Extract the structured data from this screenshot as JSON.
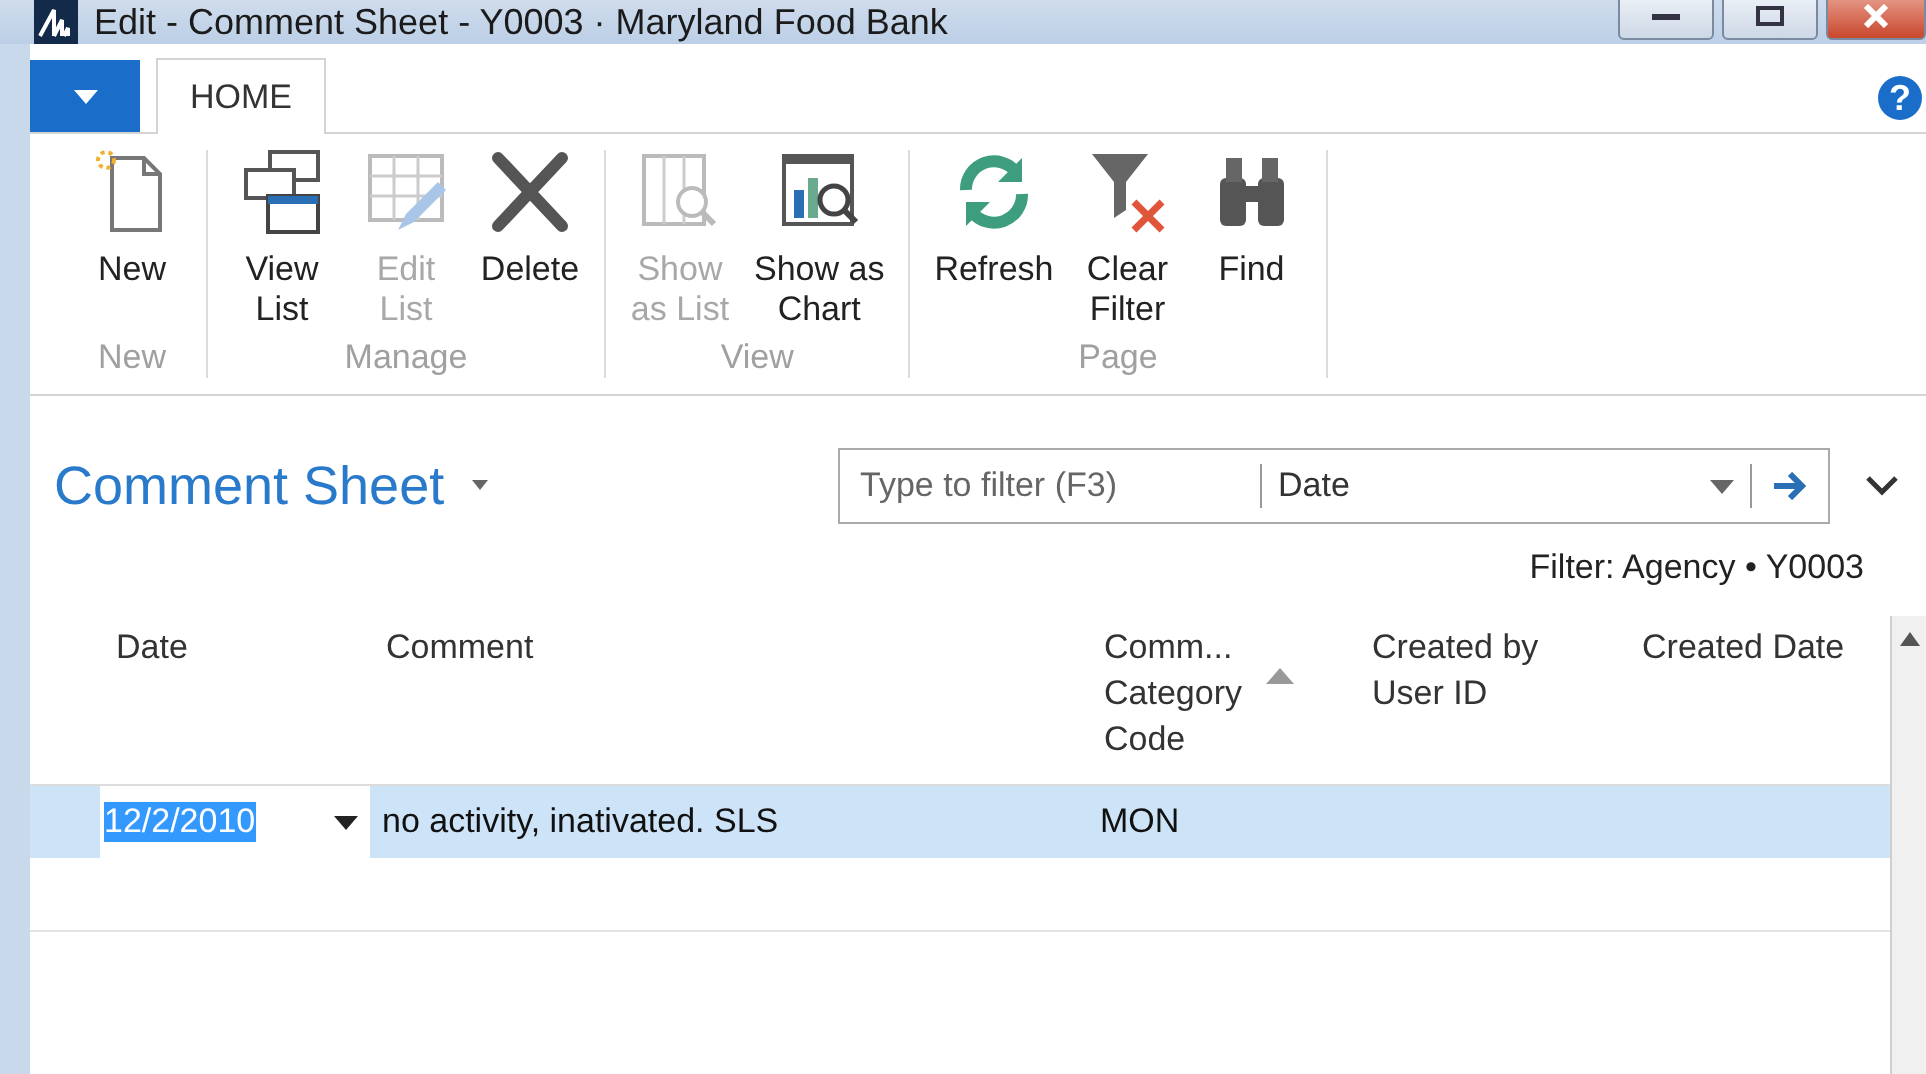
{
  "window": {
    "title": "Edit - Comment Sheet - Y0003 · Maryland Food Bank"
  },
  "tabs": [
    {
      "label": "HOME",
      "selected": true
    }
  ],
  "help": "?",
  "ribbon": [
    {
      "label": "New",
      "buttons": [
        {
          "lines": [
            "New"
          ],
          "kind": "new",
          "disabled": false
        }
      ]
    },
    {
      "label": "Manage",
      "buttons": [
        {
          "lines": [
            "View",
            "List"
          ],
          "kind": "viewlist",
          "disabled": false
        },
        {
          "lines": [
            "Edit",
            "List"
          ],
          "kind": "editlist",
          "disabled": true
        },
        {
          "lines": [
            "Delete"
          ],
          "kind": "delete",
          "disabled": false
        }
      ]
    },
    {
      "label": "View",
      "buttons": [
        {
          "lines": [
            "Show",
            "as List"
          ],
          "kind": "showlist",
          "disabled": true
        },
        {
          "lines": [
            "Show as",
            "Chart"
          ],
          "kind": "showchart",
          "disabled": false
        }
      ]
    },
    {
      "label": "Page",
      "buttons": [
        {
          "lines": [
            "Refresh"
          ],
          "kind": "refresh",
          "disabled": false
        },
        {
          "lines": [
            "Clear",
            "Filter"
          ],
          "kind": "clearfilter",
          "disabled": false
        },
        {
          "lines": [
            "Find"
          ],
          "kind": "find",
          "disabled": false
        }
      ]
    }
  ],
  "page": {
    "title": "Comment Sheet",
    "filter": {
      "placeholder": "Type to filter (F3)",
      "field": "Date"
    },
    "filter_caption": "Filter: Agency • Y0003"
  },
  "table": {
    "columns": [
      {
        "lines": [
          "Date"
        ],
        "sorted": false
      },
      {
        "lines": [
          "Comment"
        ],
        "sorted": false
      },
      {
        "lines": [
          "Comm...",
          "Category",
          "Code"
        ],
        "sorted": true
      },
      {
        "lines": [
          "Created by",
          "User ID"
        ],
        "sorted": false
      },
      {
        "lines": [
          "Created Date"
        ],
        "sorted": false
      }
    ],
    "rows": [
      {
        "selected": true,
        "cells": [
          "12/2/2010",
          "no activity, inativated. SLS",
          "MON"
        ]
      }
    ]
  }
}
